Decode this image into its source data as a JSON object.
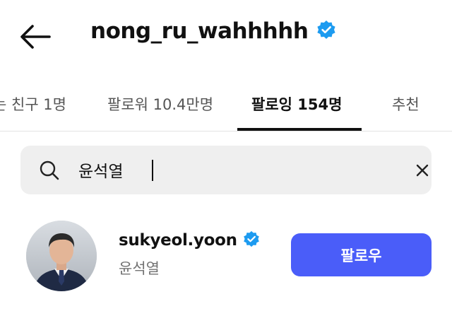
{
  "header": {
    "title": "nong_ru_wahhhhh",
    "back_icon": "arrow-left-icon",
    "verified_icon": "verified-badge-icon"
  },
  "tabs": [
    {
      "label": "는 친구 1명",
      "active": false
    },
    {
      "label": "팔로워 10.4만명",
      "active": false
    },
    {
      "label": "팔로잉 154명",
      "active": true
    },
    {
      "label": "추천",
      "active": false
    }
  ],
  "search": {
    "value": "윤석열",
    "search_icon": "search-icon",
    "clear_icon": "close-icon"
  },
  "result": {
    "username": "sukyeol.yoon",
    "full_name": "윤석열",
    "follow_label": "팔로우",
    "verified_icon": "verified-badge-icon"
  },
  "colors": {
    "verified_blue": "#1d9bf0",
    "follow_button": "#4a5df9",
    "search_background": "#efefef",
    "secondary_text": "#737373"
  }
}
